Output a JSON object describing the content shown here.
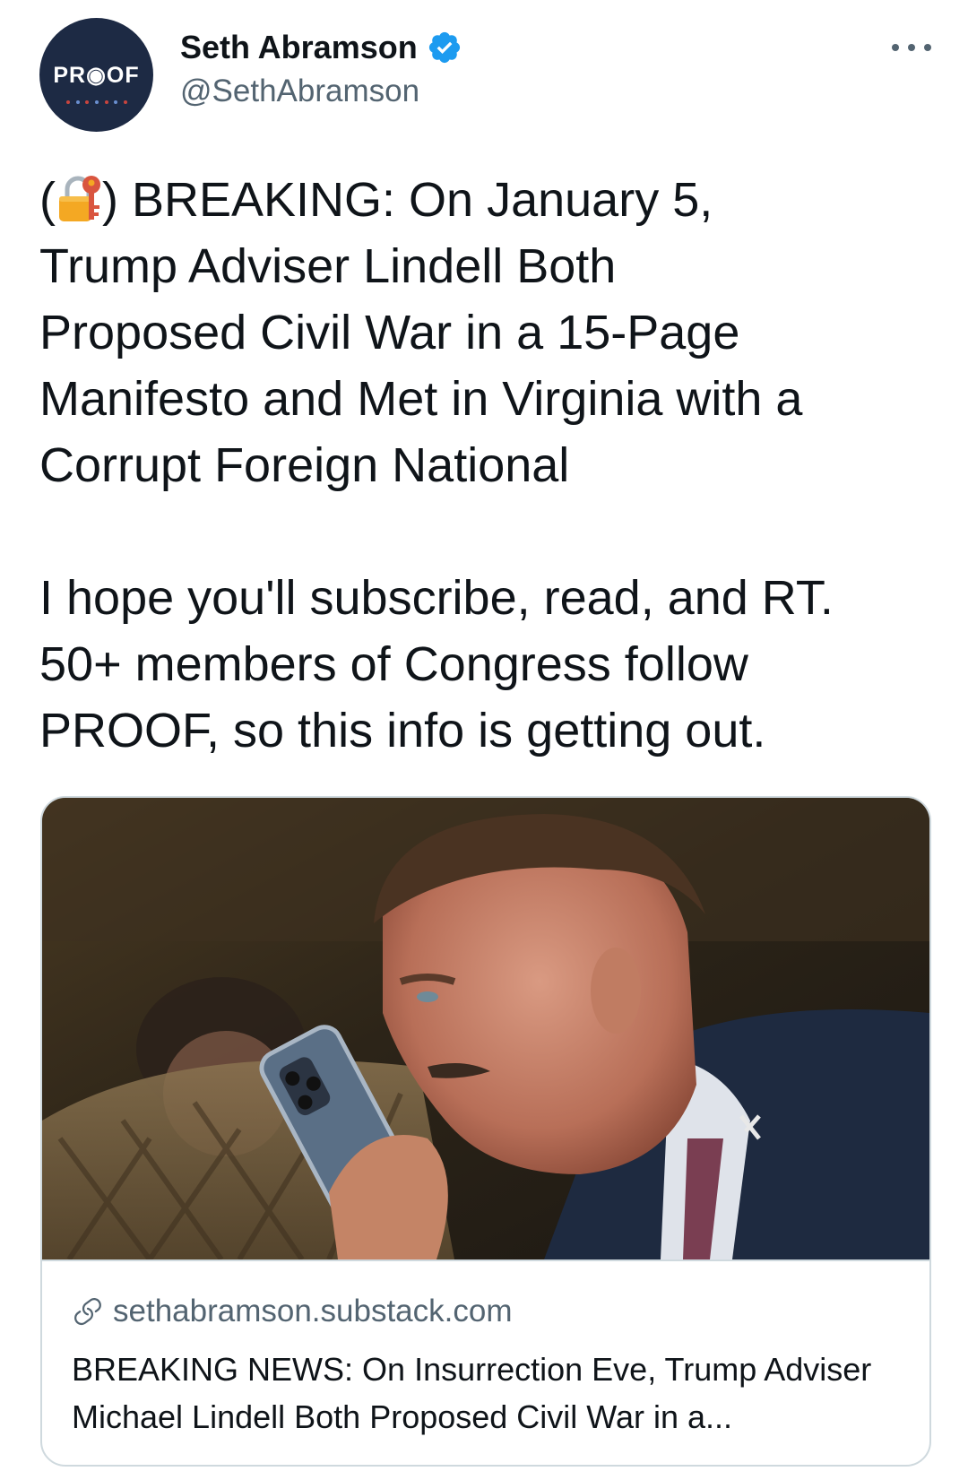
{
  "author": {
    "avatar_text": "PR◉OF",
    "display_name": "Seth Abramson",
    "handle": "@SethAbramson",
    "verified": true,
    "verified_color": "#1d9bf0"
  },
  "tweet": {
    "line1_open": "(",
    "line1_close": ") BREAKING: On January 5,",
    "lines_rest": [
      "Trump Adviser Lindell Both",
      "Proposed Civil War in a 15-Page",
      "Manifesto and Met in Virginia with a",
      "Corrupt Foreign National"
    ],
    "paragraph2": [
      "I hope you'll subscribe, read, and RT.",
      "50+ members of Congress follow",
      "PROOF, so this info is getting out."
    ],
    "icon": "locked-with-key-icon"
  },
  "card": {
    "image_subject": "man-on-phone-photo",
    "domain": "sethabramson.substack.com",
    "title_line1": "BREAKING NEWS: On Insurrection Eve, Trump Adviser",
    "title_line2": "Michael Lindell Both Proposed Civil War in a..."
  },
  "icons": {
    "more": "more-options-icon",
    "link": "link-icon",
    "verified": "verified-badge-icon"
  },
  "colors": {
    "text": "#0f1419",
    "secondary": "#536471",
    "border": "#cfd9de",
    "avatar_bg": "#1d2a44"
  }
}
